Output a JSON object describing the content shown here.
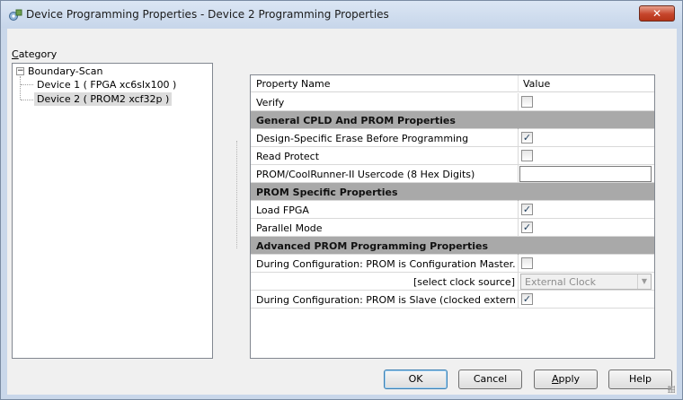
{
  "window": {
    "title": "Device Programming Properties - Device 2 Programming Properties",
    "close_glyph": "✕",
    "app_icon": "gear-chip-icon"
  },
  "category": {
    "label_prefix": "C",
    "label_rest": "ategory"
  },
  "tree": {
    "toggle_glyph": "−",
    "root": "Boundary-Scan",
    "children": [
      "Device 1 ( FPGA xc6slx100 )",
      "Device 2 ( PROM2 xcf32p )"
    ]
  },
  "grid": {
    "headers": {
      "name": "Property Name",
      "value": "Value"
    },
    "rows": [
      {
        "type": "check",
        "name": "Verify",
        "checked": false
      },
      {
        "type": "group",
        "name": "General CPLD And PROM Properties"
      },
      {
        "type": "check",
        "name": "Design-Specific Erase Before Programming",
        "checked": true
      },
      {
        "type": "check",
        "name": "Read Protect",
        "checked": false
      },
      {
        "type": "text",
        "name": "PROM/CoolRunner-II Usercode (8 Hex Digits)",
        "value": ""
      },
      {
        "type": "group",
        "name": "PROM Specific Properties"
      },
      {
        "type": "check",
        "name": "Load FPGA",
        "checked": true
      },
      {
        "type": "check",
        "name": "Parallel Mode",
        "checked": true
      },
      {
        "type": "group",
        "name": "Advanced PROM Programming Properties"
      },
      {
        "type": "check",
        "name": "During Configuration: PROM is Configuration Master...",
        "checked": false
      },
      {
        "type": "combo",
        "name": "[select clock source]",
        "value": "External Clock",
        "disabled": true
      },
      {
        "type": "check",
        "name": "During Configuration: PROM is Slave (clocked extern...",
        "checked": true
      }
    ],
    "check_glyph": "✓",
    "combo_arrow_glyph": "▼"
  },
  "buttons": {
    "ok": "OK",
    "cancel": "Cancel",
    "apply_prefix": "A",
    "apply_rest": "pply",
    "help": "Help"
  },
  "colors": {
    "title_bg": "#c7d6ea",
    "group_row": "#a9a9a9",
    "close_button": "#c6452c"
  }
}
